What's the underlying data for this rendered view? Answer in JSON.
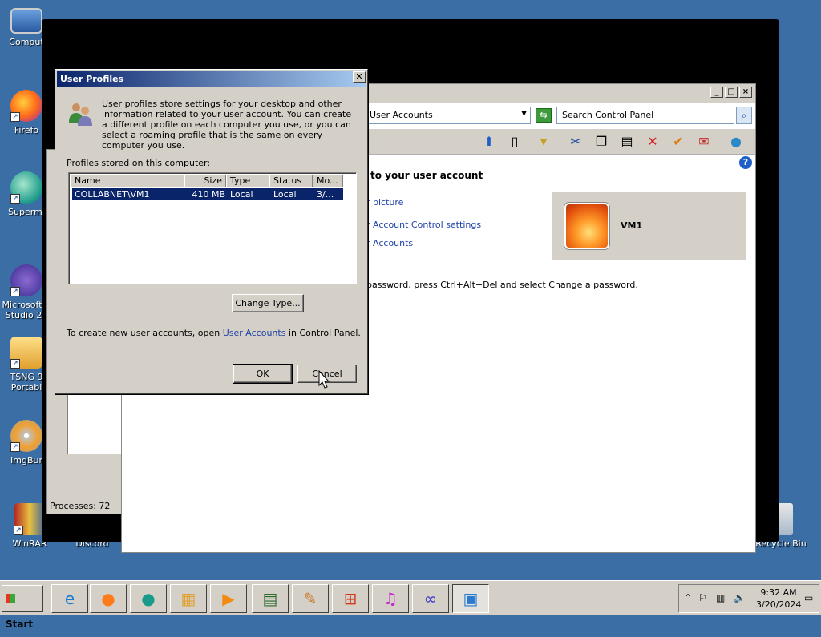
{
  "desktop": {
    "icons": [
      {
        "label": "Comput",
        "name": "computer"
      },
      {
        "label": "Firefo",
        "name": "firefox"
      },
      {
        "label": "Supermi",
        "name": "supermium"
      },
      {
        "label": "Microsoft V Studio 20",
        "name": "visual-studio"
      },
      {
        "label": "TSNG 9 Portabl",
        "name": "tsng-portable"
      },
      {
        "label": "ImgBur",
        "name": "imgburn"
      },
      {
        "label": "WinRAR",
        "name": "winrar"
      },
      {
        "label": "Discord",
        "name": "discord"
      },
      {
        "label": "Recycle Bin",
        "name": "recycle-bin"
      }
    ]
  },
  "task_manager": {
    "status": "Processes: 72"
  },
  "control_panel": {
    "address": "User Accounts",
    "search_placeholder": "Search Control Panel",
    "heading": "to your user account",
    "links": [
      "r picture",
      "r Account Control settings",
      "r Accounts"
    ],
    "user_name": "VM1",
    "password_text": "password, press Ctrl+Alt+Del and select Change a password."
  },
  "dialog": {
    "title": "User Profiles",
    "description": "User profiles store settings for your desktop and other information related to your user account. You can create a different profile on each computer you use, or you can select a roaming profile that is the same on every computer you use.",
    "stored_label": "Profiles stored on this computer:",
    "columns": [
      "Name",
      "Size",
      "Type",
      "Status",
      "Mo..."
    ],
    "rows": [
      {
        "name": "COLLABNET\\VM1",
        "size": "410 MB",
        "type": "Local",
        "status": "Local",
        "modified": "3/..."
      }
    ],
    "change_type": "Change Type...",
    "create_prefix": "To create new user accounts, open ",
    "create_link": "User Accounts",
    "create_suffix": " in Control Panel.",
    "ok": "OK",
    "cancel": "Cancel"
  },
  "taskbar": {
    "start": "Start",
    "clock_time": "9:32 AM",
    "clock_date": "3/20/2024"
  },
  "colors": {
    "desktop": "#3a6ea5",
    "selection": "#0a246a",
    "link": "#1a3fa8"
  }
}
